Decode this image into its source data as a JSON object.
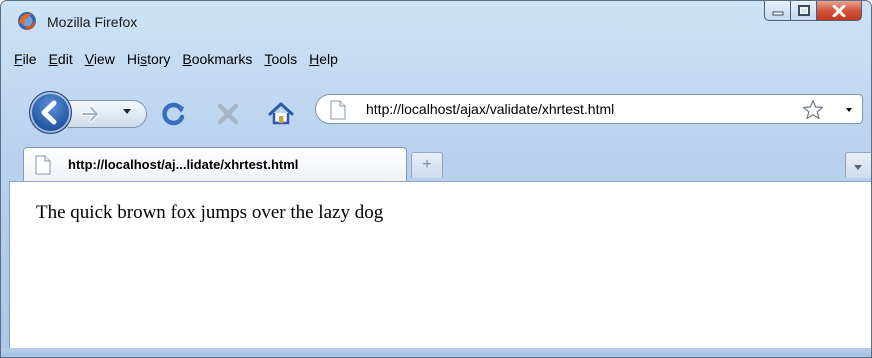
{
  "window": {
    "title": "Mozilla Firefox"
  },
  "menubar": {
    "items": [
      {
        "label": "File",
        "mnemonic": "F",
        "rest": "ile"
      },
      {
        "label": "Edit",
        "mnemonic": "E",
        "rest": "dit"
      },
      {
        "label": "View",
        "mnemonic": "V",
        "rest": "iew"
      },
      {
        "label": "History",
        "pre": "Hi",
        "mnemonic": "s",
        "rest": "tory"
      },
      {
        "label": "Bookmarks",
        "mnemonic": "B",
        "rest": "ookmarks"
      },
      {
        "label": "Tools",
        "mnemonic": "T",
        "rest": "ools"
      },
      {
        "label": "Help",
        "mnemonic": "H",
        "rest": "elp"
      }
    ]
  },
  "navbar": {
    "url": "http://localhost/ajax/validate/xhrtest.html",
    "icons": [
      "back-arrow-icon",
      "forward-arrow-icon",
      "reload-icon",
      "stop-icon",
      "home-icon",
      "page-icon",
      "star-icon"
    ]
  },
  "tabs": [
    {
      "title": "http://localhost/aj...lidate/xhrtest.html",
      "active": true
    }
  ],
  "newtab_glyph": "+",
  "content": {
    "text": "The quick brown fox jumps over the lazy dog"
  },
  "colors": {
    "frame": "#b9d3ef",
    "close_button": "#c3381d",
    "back_button": "#2a5fae"
  }
}
